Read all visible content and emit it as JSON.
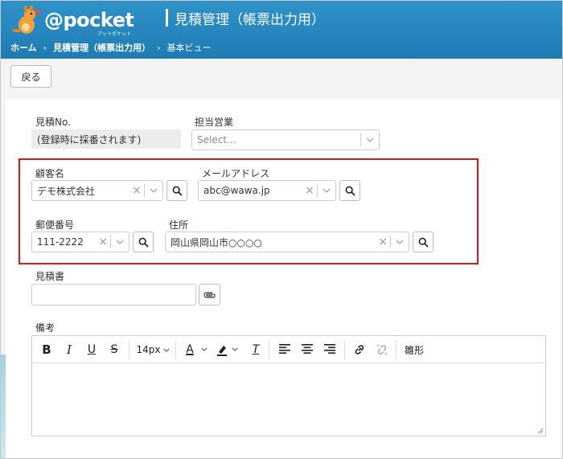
{
  "header": {
    "logo_text": "@pocket",
    "logo_sub": "アットポケット",
    "page_title": "見積管理（帳票出力用）",
    "breadcrumb": [
      "ホーム",
      "見積管理（帳票出力用）",
      "基本ビュー"
    ],
    "breadcrumb_sep": "›"
  },
  "toolbar": {
    "back_label": "戻る"
  },
  "form": {
    "estimate_no": {
      "label": "見積No.",
      "value": "(登録時に採番されます)"
    },
    "sales_rep": {
      "label": "担当営業",
      "placeholder": "Select..."
    },
    "customer": {
      "label": "顧客名",
      "value": "デモ株式会社"
    },
    "email": {
      "label": "メールアドレス",
      "value": "abc@wawa.jp"
    },
    "postal": {
      "label": "郵便番号",
      "value": "111-2222"
    },
    "address": {
      "label": "住所",
      "value": "岡山県岡山市○○○○"
    },
    "estimate_doc": {
      "label": "見積書"
    },
    "notes": {
      "label": "備考"
    }
  },
  "editor": {
    "bold": "B",
    "italic": "I",
    "underline": "U",
    "strike": "S",
    "font_size": "14px",
    "color_a": "A",
    "clear_format": "T",
    "template": "雛形"
  },
  "icons": {
    "clear": "×",
    "chevron": "chevron-down-icon",
    "search": "search-icon",
    "attach": "paperclip-icon"
  },
  "colors": {
    "header": "#2389c1",
    "highlight_box": "#e01515"
  }
}
